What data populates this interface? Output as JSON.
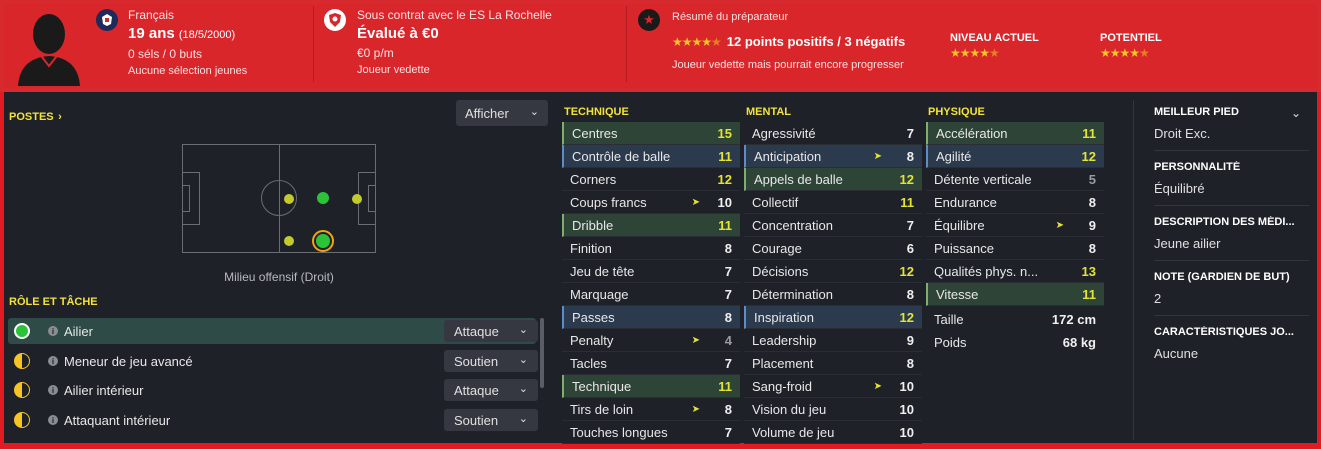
{
  "header": {
    "nationality": "Français",
    "age": "19 ans",
    "dob": "(18/5/2000)",
    "caps": "0 séls / 0 buts",
    "youth_caps": "Aucune sélection jeunes",
    "contract": "Sous contrat avec le ES La Rochelle",
    "value": "Évalué à €0",
    "wage": "€0 p/m",
    "status": "Joueur vedette",
    "report_title": "Résumé du préparateur",
    "report_summary": "12 points positifs / 3 négatifs",
    "report_comment": "Joueur vedette mais pourrait encore progresser",
    "current_level_label": "NIVEAU ACTUEL",
    "potential_label": "POTENTIEL",
    "report_stars": 4.5,
    "current_stars": 4.5,
    "potential_stars": 4.5,
    "accent_color": "#d8262b"
  },
  "positions": {
    "title": "POSTES",
    "show_button": "Afficher",
    "position_label": "Milieu offensif (Droit)"
  },
  "roles": {
    "title": "RÔLE ET TÂCHE",
    "items": [
      {
        "name": "Ailier",
        "duty": "Attaque"
      },
      {
        "name": "Meneur de jeu avancé",
        "duty": "Soutien"
      },
      {
        "name": "Ailier intérieur",
        "duty": "Attaque"
      },
      {
        "name": "Attaquant intérieur",
        "duty": "Soutien"
      }
    ]
  },
  "technique": {
    "title": "TECHNIQUE",
    "items": [
      {
        "name": "Centres",
        "value": "15"
      },
      {
        "name": "Contrôle de balle",
        "value": "11"
      },
      {
        "name": "Corners",
        "value": "12"
      },
      {
        "name": "Coups francs",
        "value": "10"
      },
      {
        "name": "Dribble",
        "value": "11"
      },
      {
        "name": "Finition",
        "value": "8"
      },
      {
        "name": "Jeu de tête",
        "value": "7"
      },
      {
        "name": "Marquage",
        "value": "7"
      },
      {
        "name": "Passes",
        "value": "8"
      },
      {
        "name": "Penalty",
        "value": "4"
      },
      {
        "name": "Tacles",
        "value": "7"
      },
      {
        "name": "Technique",
        "value": "11"
      },
      {
        "name": "Tirs de loin",
        "value": "8"
      },
      {
        "name": "Touches longues",
        "value": "7"
      }
    ]
  },
  "mental": {
    "title": "MENTAL",
    "items": [
      {
        "name": "Agressivité",
        "value": "7"
      },
      {
        "name": "Anticipation",
        "value": "8"
      },
      {
        "name": "Appels de balle",
        "value": "12"
      },
      {
        "name": "Collectif",
        "value": "11"
      },
      {
        "name": "Concentration",
        "value": "7"
      },
      {
        "name": "Courage",
        "value": "6"
      },
      {
        "name": "Décisions",
        "value": "12"
      },
      {
        "name": "Détermination",
        "value": "8"
      },
      {
        "name": "Inspiration",
        "value": "12"
      },
      {
        "name": "Leadership",
        "value": "9"
      },
      {
        "name": "Placement",
        "value": "8"
      },
      {
        "name": "Sang-froid",
        "value": "10"
      },
      {
        "name": "Vision du jeu",
        "value": "10"
      },
      {
        "name": "Volume de jeu",
        "value": "10"
      }
    ]
  },
  "physique": {
    "title": "PHYSIQUE",
    "items": [
      {
        "name": "Accélération",
        "value": "11"
      },
      {
        "name": "Agilité",
        "value": "12"
      },
      {
        "name": "Détente verticale",
        "value": "5"
      },
      {
        "name": "Endurance",
        "value": "8"
      },
      {
        "name": "Équilibre",
        "value": "9"
      },
      {
        "name": "Puissance",
        "value": "8"
      },
      {
        "name": "Qualités phys. n...",
        "value": "13"
      },
      {
        "name": "Vitesse",
        "value": "11"
      }
    ],
    "height_label": "Taille",
    "height": "172 cm",
    "weight_label": "Poids",
    "weight": "68 kg"
  },
  "info": {
    "foot_title": "MEILLEUR PIED",
    "foot": "Droit Exc.",
    "personality_title": "PERSONNALITÉ",
    "personality": "Équilibré",
    "media_title": "DESCRIPTION DES MÉDI...",
    "media": "Jeune ailier",
    "gk_title": "NOTE (GARDIEN DE BUT)",
    "gk": "2",
    "traits_title": "CARACTÉRISTIQUES JO...",
    "traits": "Aucune"
  }
}
